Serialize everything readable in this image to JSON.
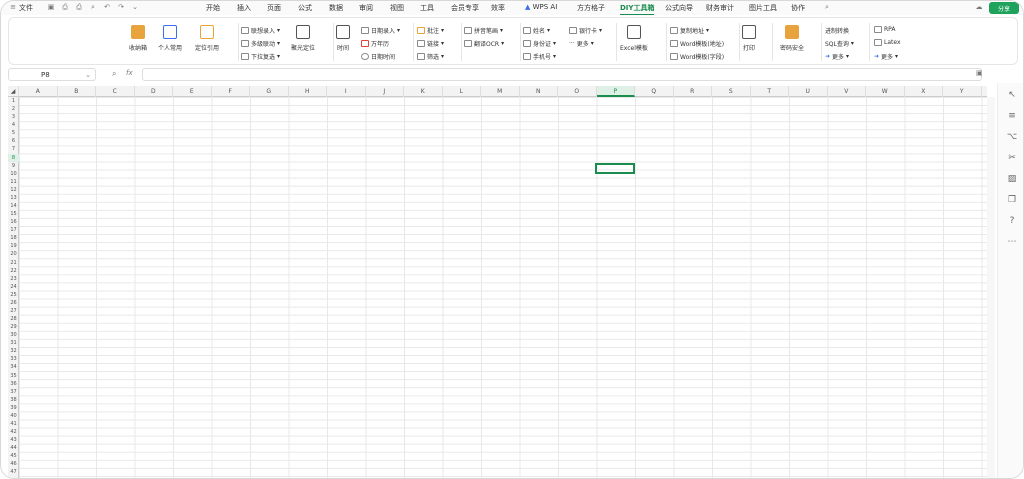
{
  "app": {
    "file_menu": "文件"
  },
  "menu": [
    {
      "label": "开始"
    },
    {
      "label": "插入"
    },
    {
      "label": "页面"
    },
    {
      "label": "公式"
    },
    {
      "label": "数据"
    },
    {
      "label": "审阅"
    },
    {
      "label": "视图"
    },
    {
      "label": "工具"
    },
    {
      "label": "会员专享"
    },
    {
      "label": "效率"
    },
    {
      "label": "WPS AI"
    },
    {
      "label": "方方格子"
    },
    {
      "label": "DIY工具箱",
      "active": true
    },
    {
      "label": "公式向导"
    },
    {
      "label": "财务审计"
    },
    {
      "label": "图片工具"
    },
    {
      "label": "协作"
    }
  ],
  "share_label": "分享",
  "ribbon": {
    "collect": "收纳箱",
    "personal": "个人常用",
    "locate_ref": "定位引用",
    "linkage_entry": "联想录入",
    "multi_linkage": "多级联动",
    "dropdown_multi": "下拉复选",
    "focus_locate": "聚光定位",
    "time": "时间",
    "date_entry": "日期录入",
    "perpetual_cal": "万年历",
    "datetime": "日期时间",
    "annotate": "批注",
    "link": "链接",
    "filter": "筛选",
    "pinyin": "拼音笔画",
    "translate_ocr": "翻译OCR",
    "name": "姓名",
    "id_card": "身份证",
    "phone": "手机号",
    "bank_card": "银行卡",
    "more1": "更多",
    "excel_template": "Excel模板",
    "copy_address": "复制地址",
    "word_template_addr": "Word模板(地址)",
    "word_template_field": "Word模板(字段)",
    "print": "打印",
    "password_security": "密码安全",
    "base_convert": "进制转换",
    "sql_query": "SQL查询",
    "more2": "更多",
    "rpa": "RPA",
    "latex": "Latex",
    "more3": "更多"
  },
  "formula_bar": {
    "name_box": "P8",
    "fx": "fx",
    "value": ""
  },
  "columns": [
    "A",
    "B",
    "C",
    "D",
    "E",
    "F",
    "G",
    "H",
    "I",
    "J",
    "K",
    "L",
    "M",
    "N",
    "O",
    "P",
    "Q",
    "R",
    "S",
    "T",
    "U",
    "V",
    "W",
    "X",
    "Y"
  ],
  "selected_column": "P",
  "rows": [
    "1",
    "2",
    "3",
    "4",
    "5",
    "6",
    "7",
    "8",
    "9",
    "10",
    "11",
    "12",
    "13",
    "14",
    "15",
    "16",
    "17",
    "18",
    "19",
    "20",
    "21",
    "22",
    "23",
    "24",
    "25",
    "26",
    "27",
    "28",
    "29",
    "30",
    "31",
    "32",
    "33",
    "34",
    "35",
    "36",
    "37",
    "38",
    "39",
    "40",
    "41",
    "42",
    "43",
    "44",
    "45",
    "46",
    "47"
  ],
  "selected_row": "8",
  "colors": {
    "accent": "#1a8c4e",
    "share_bg": "#1fa25b"
  }
}
